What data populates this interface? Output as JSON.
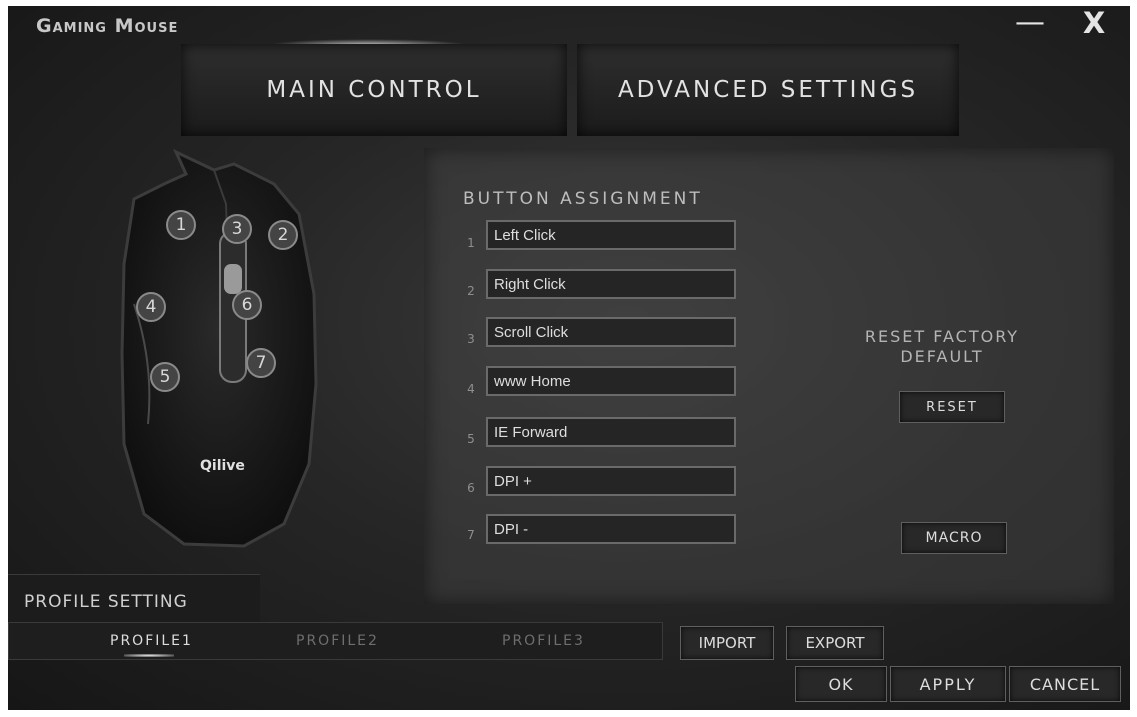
{
  "window": {
    "title": "Gaming Mouse",
    "minimize_icon": "minimize-icon",
    "close_icon": "close-icon"
  },
  "tabs": [
    {
      "label": "MAIN CONTROL"
    },
    {
      "label": "ADVANCED SETTINGS"
    }
  ],
  "mouse": {
    "brand": "Qilive",
    "markers": [
      "1",
      "2",
      "3",
      "4",
      "5",
      "6",
      "7"
    ]
  },
  "button_assignment": {
    "title": "BUTTON ASSIGNMENT",
    "rows": [
      {
        "number": "1",
        "value": "Left Click"
      },
      {
        "number": "2",
        "value": "Right Click"
      },
      {
        "number": "3",
        "value": "Scroll Click"
      },
      {
        "number": "4",
        "value": "www Home"
      },
      {
        "number": "5",
        "value": "IE Forward"
      },
      {
        "number": "6",
        "value": "DPI +"
      },
      {
        "number": "7",
        "value": "DPI -"
      }
    ]
  },
  "reset": {
    "label_line1": "RESET FACTORY",
    "label_line2": "DEFAULT",
    "button": "RESET"
  },
  "macro": {
    "button": "MACRO"
  },
  "profile": {
    "title": "PROFILE SETTING",
    "items": [
      "PROFILE1",
      "PROFILE2",
      "PROFILE3"
    ],
    "import": "IMPORT",
    "export": "EXPORT"
  },
  "actions": {
    "ok": "OK",
    "apply": "APPLY",
    "cancel": "CANCEL"
  },
  "colors": {
    "background": "#262626",
    "text": "#dedede",
    "field_border": "#6a6a6a"
  }
}
